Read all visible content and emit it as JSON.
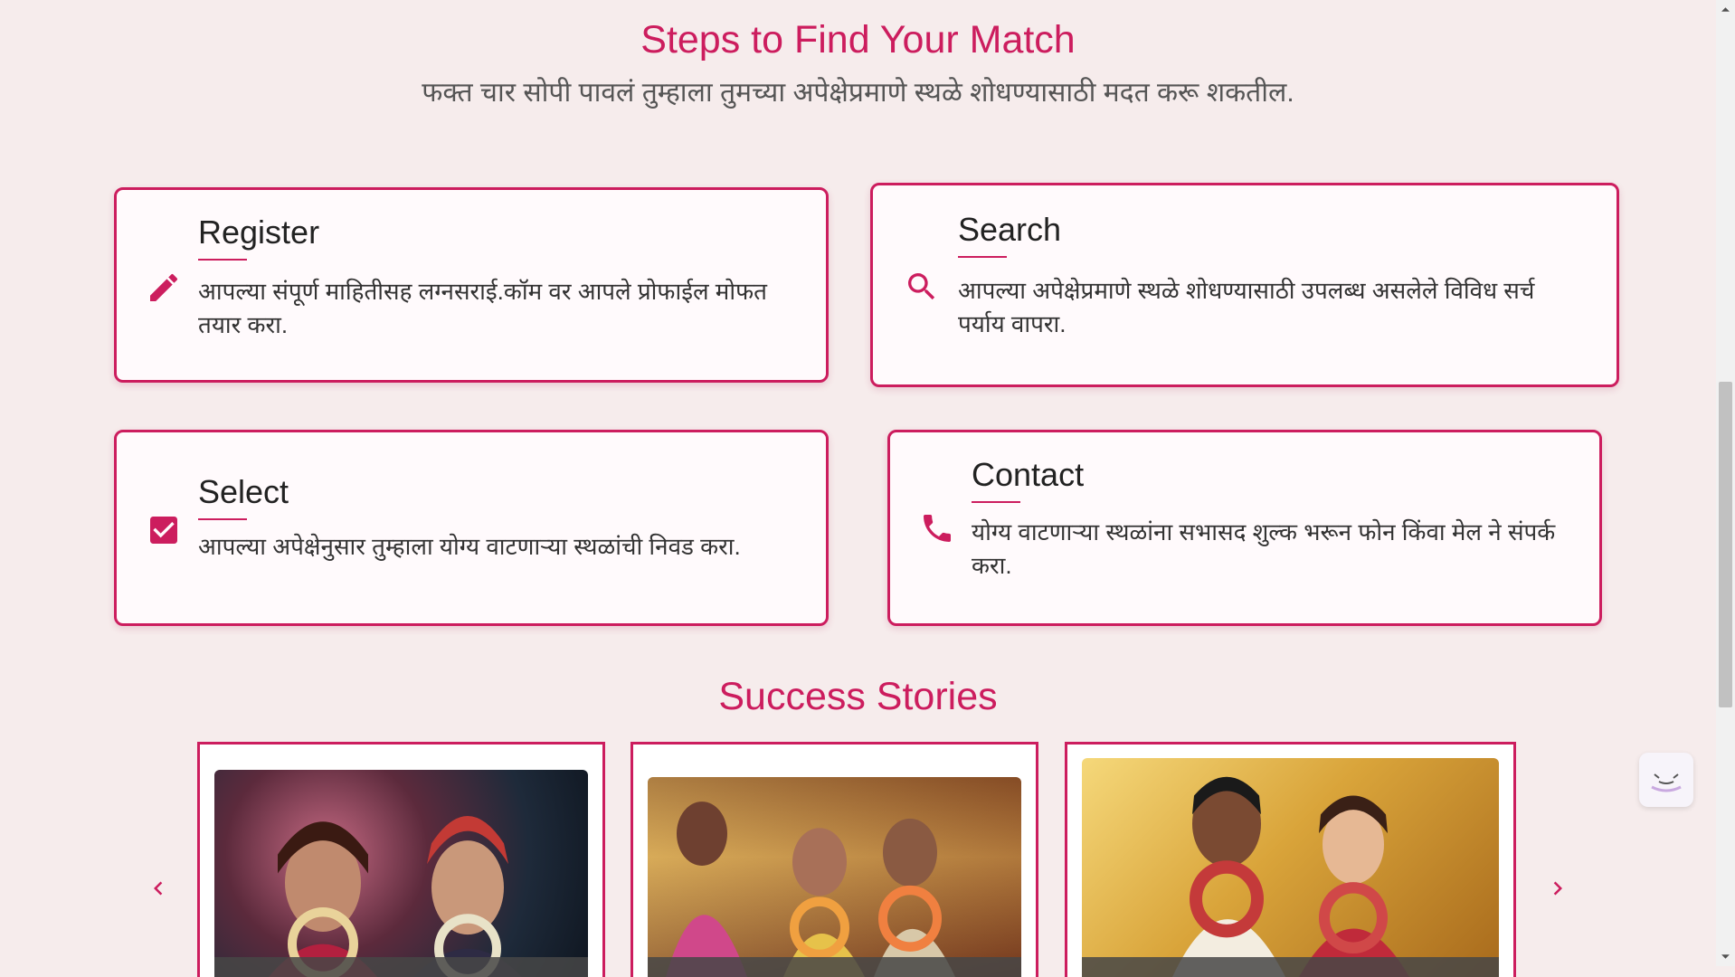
{
  "steps_section": {
    "title": "Steps to Find Your Match",
    "subtitle": "फक्त चार सोपी पावलं तुम्हाला तुमच्या अपेक्षेप्रमाणे स्थळे शोधण्यासाठी मदत करू शकतील."
  },
  "steps": [
    {
      "icon": "pencil-icon",
      "title": "Register",
      "description_line1": "आपल्या संपूर्ण माहितीसह लग्नसराई.कॉम वर आपले प्रोफाईल मोफत",
      "description_line2": "तयार करा."
    },
    {
      "icon": "search-icon",
      "title": "Search",
      "description_line1": "आपल्या अपेक्षेप्रमाणे स्थळे शोधण्यासाठी उपलब्ध असलेले विविध सर्च",
      "description_line2": "पर्याय वापरा."
    },
    {
      "icon": "checkbox-icon",
      "title": "Select",
      "description_line1": "आपल्या अपेक्षेनुसार तुम्हाला योग्य वाटणाऱ्या स्थळांची निवड करा.",
      "description_line2": ""
    },
    {
      "icon": "phone-icon",
      "title": "Contact",
      "description_line1": "योग्य वाटणाऱ्या स्थळांना सभासद शुल्क भरून फोन किंवा मेल ने संपर्क",
      "description_line2": "करा."
    }
  ],
  "stories_section": {
    "title": "Success Stories",
    "prev_icon": "chevron-left-icon",
    "next_icon": "chevron-right-icon",
    "stories": [
      {
        "image": "couple-photo-1"
      },
      {
        "image": "couple-photo-2"
      },
      {
        "image": "couple-photo-3"
      }
    ]
  },
  "colors": {
    "accent": "#cc1d5e",
    "background": "#f6ecec",
    "card_background": "#fffafc"
  }
}
